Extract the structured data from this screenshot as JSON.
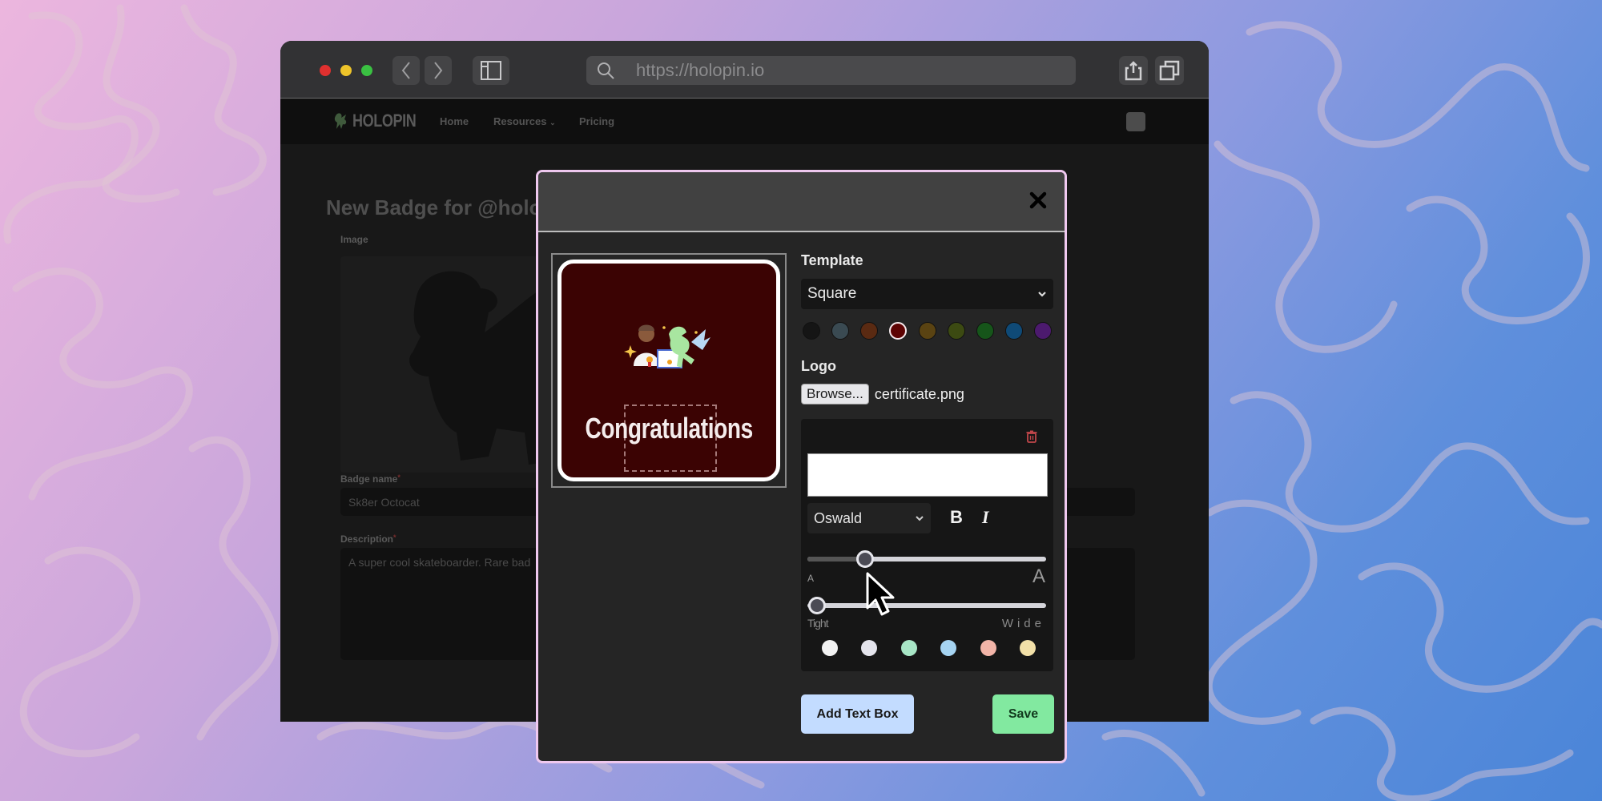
{
  "browser": {
    "url": "https://holopin.io"
  },
  "site": {
    "logo_text": "HOLOPIN",
    "nav": [
      {
        "label": "Home"
      },
      {
        "label": "Resources"
      },
      {
        "label": "Pricing"
      }
    ]
  },
  "form": {
    "title": "New Badge for @holo",
    "image_label": "Image",
    "name_label": "Badge name",
    "name_value": "Sk8er Octocat",
    "description_label": "Description",
    "description_value": "A super cool skateboarder. Rare bad",
    "required_mark": "*"
  },
  "modal": {
    "close_icon": "close-icon",
    "preview": {
      "badge_text": "Congratulations",
      "badge_bg": "#3b0303"
    },
    "template": {
      "label": "Template",
      "selected": "Square",
      "colors": [
        "#151515",
        "#3a4a52",
        "#5a2a12",
        "#5e0303",
        "#5a4312",
        "#3c4a12",
        "#16551a",
        "#0f4a77",
        "#4c1a6e"
      ],
      "selected_color_index": 3
    },
    "logo": {
      "label": "Logo",
      "browse_label": "Browse...",
      "file_name": "certificate.png"
    },
    "text_box": {
      "text_value": "",
      "font": "Oswald",
      "bold_label": "B",
      "italic_label": "I",
      "size_small_label": "A",
      "size_large_label": "A",
      "size_value_pct": 24,
      "spacing_min_label": "Tight",
      "spacing_max_label": "Wide",
      "spacing_value_pct": 4,
      "text_colors": [
        "#f2f2f2",
        "#e4e4ec",
        "#a8e6c6",
        "#a6d4f2",
        "#f2b4a8",
        "#f2e0a8"
      ]
    },
    "add_text_box_label": "Add Text Box",
    "save_label": "Save"
  }
}
